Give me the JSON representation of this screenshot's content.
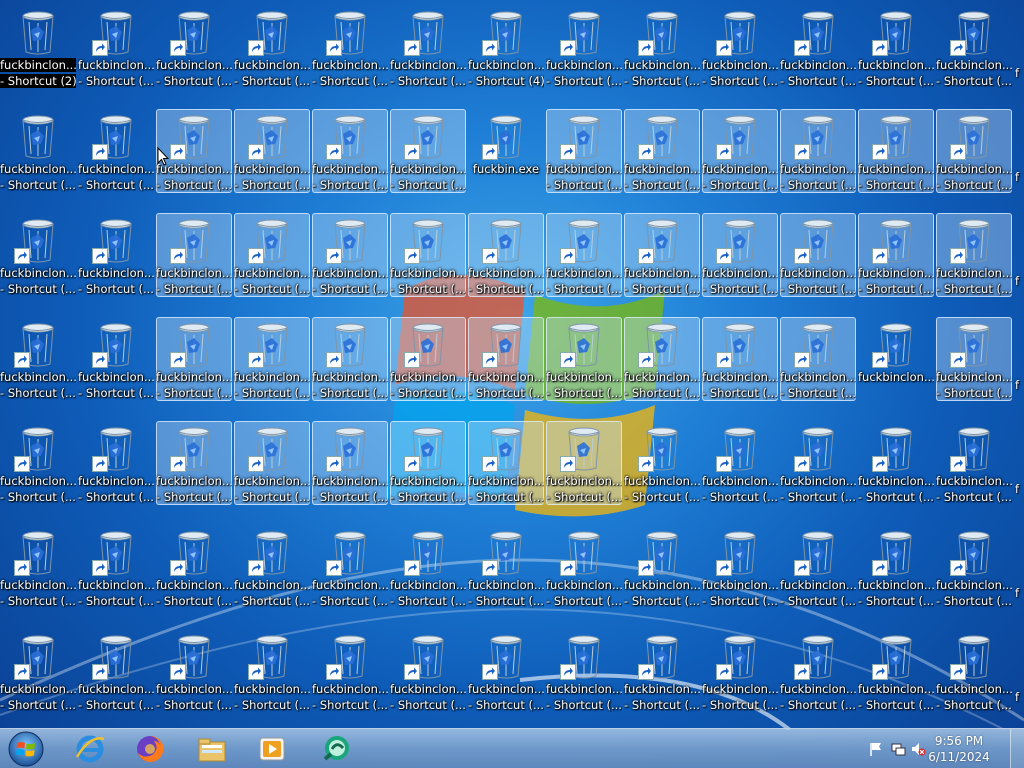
{
  "desktop": {
    "shortcut_name": "fuckbinclon...",
    "shortcut_suffix": "- Shortcut (...",
    "first_icon_suffix": "- Shortcut (2)",
    "icon_row1_col7_suffix": "- Shortcut (4)",
    "exe_name": "fuckbin.exe",
    "partial_edge_label": "f"
  },
  "taskbar": {
    "clock_time": "9:56 PM",
    "clock_date": "6/11/2024",
    "pinned": [
      {
        "name": "internet-explorer-icon"
      },
      {
        "name": "firefox-icon"
      },
      {
        "name": "file-explorer-icon"
      },
      {
        "name": "media-player-icon"
      },
      {
        "name": "app-icon"
      }
    ],
    "tray_icons": [
      "flag-icon",
      "network-icon",
      "volume-muted-icon"
    ]
  },
  "colors": {
    "desktop_bg": "#1f7fd6",
    "selection": "#c8e1fa"
  }
}
